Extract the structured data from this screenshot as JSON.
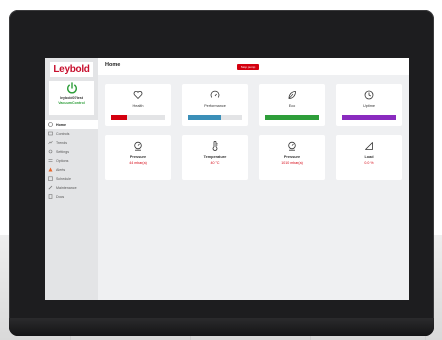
{
  "app": {
    "logo_text": "Leybold",
    "device_name": "leybold07test",
    "device_model": "VacuumControl"
  },
  "header": {
    "title": "Home",
    "stop_label": "Stop pump"
  },
  "sidebar": {
    "items": [
      {
        "label": "Home",
        "icon": "home-icon",
        "active": true
      },
      {
        "label": "Controls",
        "icon": "controls-icon"
      },
      {
        "label": "Trends",
        "icon": "trends-icon"
      },
      {
        "label": "Settings",
        "icon": "settings-icon"
      },
      {
        "label": "Options",
        "icon": "options-icon"
      },
      {
        "label": "Alerts",
        "icon": "alerts-icon"
      },
      {
        "label": "Schedule",
        "icon": "schedule-icon"
      },
      {
        "label": "Maintenance",
        "icon": "maintenance-icon"
      },
      {
        "label": "Docs",
        "icon": "docs-icon"
      }
    ]
  },
  "status_cards": [
    {
      "label": "Health",
      "icon": "heart-icon",
      "level": 0.3,
      "color": "#d4000f"
    },
    {
      "label": "Performance",
      "icon": "gauge-icon",
      "level": 0.62,
      "color": "#3b8fb8"
    },
    {
      "label": "Eco",
      "icon": "leaf-icon",
      "level": 1.0,
      "color": "#2e9e3a"
    },
    {
      "label": "Uptime",
      "icon": "clock-icon",
      "level": 1.0,
      "color": "#8a2bbf"
    }
  ],
  "metric_cards": [
    {
      "label": "Pressure",
      "icon": "pressure-gauge-icon",
      "value": "44 mbar(a)"
    },
    {
      "label": "Temperature",
      "icon": "thermometer-icon",
      "value": "40 °C"
    },
    {
      "label": "Pressure",
      "icon": "pressure-gauge-icon",
      "value": "1010 mbar(a)"
    },
    {
      "label": "Load",
      "icon": "load-icon",
      "value": "0.0 %"
    }
  ]
}
